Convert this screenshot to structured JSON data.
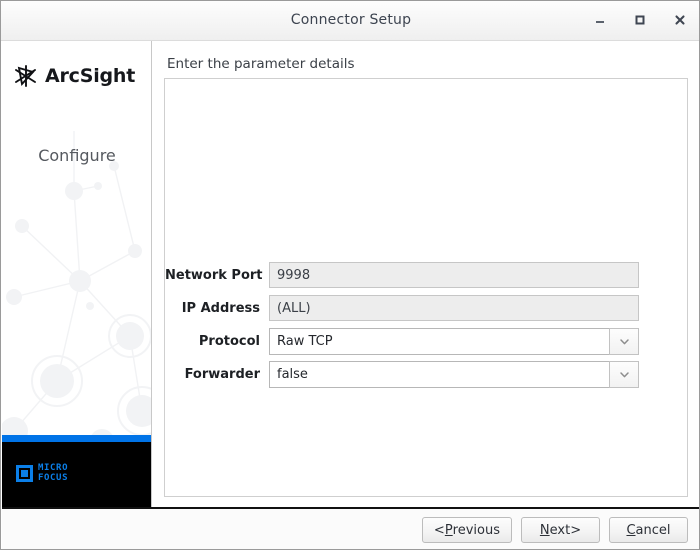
{
  "window": {
    "title": "Connector Setup",
    "controls": {
      "minimize": "minimize-icon",
      "maximize": "maximize-icon",
      "close": "close-icon"
    }
  },
  "sidebar": {
    "brand_name": "ArcSight",
    "brand_mark": "arcsight-star-icon",
    "step_label": "Configure",
    "footer_logo": {
      "line1": "MICRO",
      "line2": "FOCUS",
      "mark": "micro-focus-square-icon",
      "accent_color": "#0b7fe8",
      "bar_color": "#0073e7",
      "background": "#000000"
    }
  },
  "main": {
    "heading": "Enter the parameter details",
    "fields": [
      {
        "label": "Network Port",
        "value": "9998",
        "type": "text",
        "readonly": true
      },
      {
        "label": "IP Address",
        "value": "(ALL)",
        "type": "text",
        "readonly": true
      },
      {
        "label": "Protocol",
        "value": "Raw TCP",
        "type": "combo",
        "readonly": false
      },
      {
        "label": "Forwarder",
        "value": "false",
        "type": "combo",
        "readonly": false
      }
    ]
  },
  "footer": {
    "buttons": [
      {
        "prefix": "< ",
        "mnemonic": "P",
        "rest": "revious",
        "suffix": "",
        "name": "previous-button"
      },
      {
        "prefix": "",
        "mnemonic": "N",
        "rest": "ext",
        "suffix": " >",
        "name": "next-button"
      },
      {
        "prefix": "",
        "mnemonic": "C",
        "rest": "ancel",
        "suffix": "",
        "name": "cancel-button"
      }
    ]
  }
}
